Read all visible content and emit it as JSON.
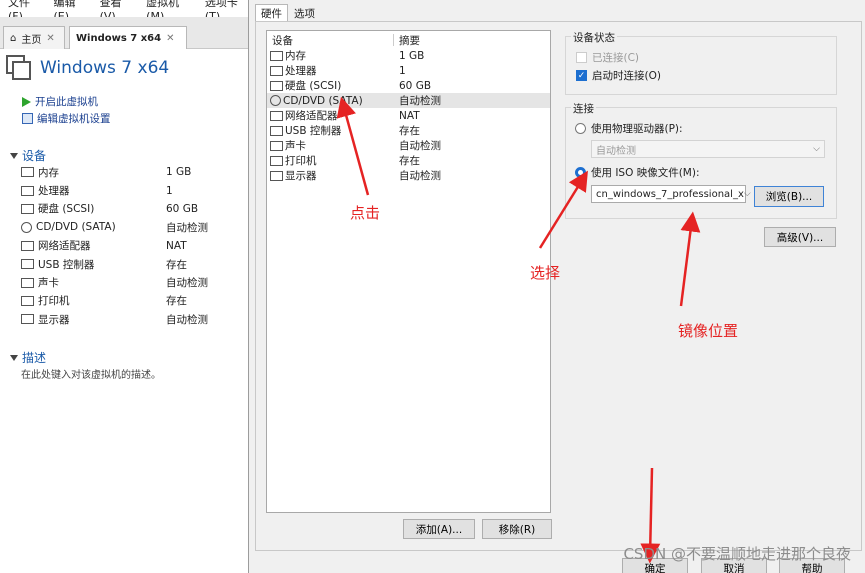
{
  "menubar": {
    "items": [
      "文件(F)",
      "编辑(E)",
      "查看(V)",
      "虚拟机(M)",
      "选项卡(T)"
    ]
  },
  "tabs": {
    "home": "主页",
    "vm": "Windows 7 x64"
  },
  "vm": {
    "title": "Windows 7 x64",
    "actions": [
      "开启此虚拟机",
      "编辑虚拟机设置"
    ],
    "devices_header": "设备",
    "devices": [
      {
        "name": "内存",
        "value": "1 GB",
        "icon": "memory-icon"
      },
      {
        "name": "处理器",
        "value": "1",
        "icon": "cpu-icon"
      },
      {
        "name": "硬盘 (SCSI)",
        "value": "60 GB",
        "icon": "harddisk-icon"
      },
      {
        "name": "CD/DVD (SATA)",
        "value": "自动检测",
        "icon": "cdrom-icon"
      },
      {
        "name": "网络适配器",
        "value": "NAT",
        "icon": "network-icon"
      },
      {
        "name": "USB 控制器",
        "value": "存在",
        "icon": "usb-icon"
      },
      {
        "name": "声卡",
        "value": "自动检测",
        "icon": "sound-icon"
      },
      {
        "name": "打印机",
        "value": "存在",
        "icon": "printer-icon"
      },
      {
        "name": "显示器",
        "value": "自动检测",
        "icon": "display-icon"
      }
    ],
    "desc_header": "描述",
    "desc_placeholder": "在此处键入对该虚拟机的描述。"
  },
  "dialog": {
    "tabs": [
      "硬件",
      "选项"
    ],
    "list_headers": [
      "设备",
      "摘要"
    ],
    "devices": [
      {
        "name": "内存",
        "summary": "1 GB",
        "icon": "memory-icon"
      },
      {
        "name": "处理器",
        "summary": "1",
        "icon": "cpu-icon"
      },
      {
        "name": "硬盘 (SCSI)",
        "summary": "60 GB",
        "icon": "harddisk-icon"
      },
      {
        "name": "CD/DVD (SATA)",
        "summary": "自动检测",
        "icon": "cdrom-icon",
        "selected": true
      },
      {
        "name": "网络适配器",
        "summary": "NAT",
        "icon": "network-icon"
      },
      {
        "name": "USB 控制器",
        "summary": "存在",
        "icon": "usb-icon"
      },
      {
        "name": "声卡",
        "summary": "自动检测",
        "icon": "sound-icon"
      },
      {
        "name": "打印机",
        "summary": "存在",
        "icon": "printer-icon"
      },
      {
        "name": "显示器",
        "summary": "自动检测",
        "icon": "display-icon"
      }
    ],
    "add_label": "添加(A)...",
    "remove_label": "移除(R)",
    "status": {
      "title": "设备状态",
      "connected": "已连接(C)",
      "connected_checked": false,
      "connect_on_power": "启动时连接(O)",
      "connect_on_power_checked": true
    },
    "connection": {
      "title": "连接",
      "physical_label": "使用物理驱动器(P):",
      "physical_value": "自动检测",
      "iso_label": "使用 ISO 映像文件(M):",
      "iso_value": "cn_windows_7_professional_x",
      "browse_label": "浏览(B)...",
      "selected": "iso"
    },
    "advanced_label": "高级(V)...",
    "ok_label": "确定",
    "cancel_label": "取消",
    "help_label": "帮助"
  },
  "annotations": {
    "click": "点击",
    "select": "选择",
    "image_location": "镜像位置",
    "color": "#e52323"
  },
  "watermark": "CSDN @不要温顺地走进那个良夜"
}
